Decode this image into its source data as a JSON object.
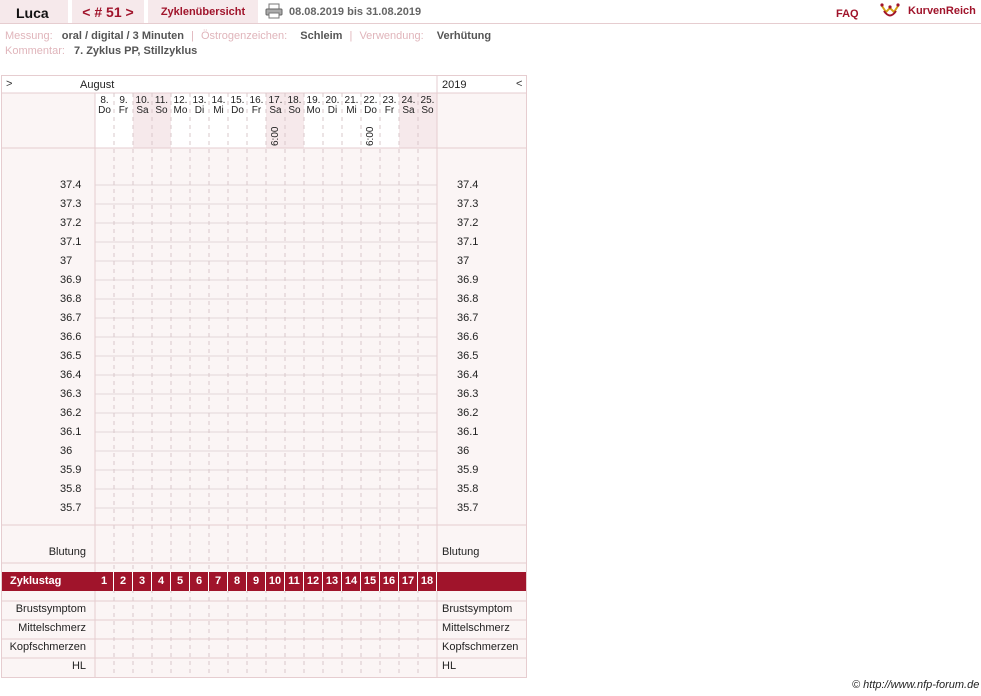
{
  "header": {
    "name": "Luca",
    "cycle_label": "< # 51 >",
    "overview_label": "Zyklenübersicht",
    "date_range": "08.08.2019 bis 31.08.2019",
    "faq_label": "FAQ",
    "brand": "KurvenReich"
  },
  "meta": {
    "messung_label": "Messung:",
    "messung_value": "oral / digital / 3 Minuten",
    "oestrogen_label": "Östrogenzeichen:",
    "oestrogen_value": "Schleim",
    "verwendung_label": "Verwendung:",
    "verwendung_value": "Verhütung",
    "kommentar_label": "Kommentar:",
    "kommentar_value": "7. Zyklus PP, Stillzyklus"
  },
  "chart": {
    "nav_prev": ">",
    "nav_next": "<",
    "month": "August",
    "year": "2019",
    "days": [
      {
        "num": "8.",
        "wd": "Do",
        "weekend": false,
        "time": ""
      },
      {
        "num": "9.",
        "wd": "Fr",
        "weekend": false,
        "time": ""
      },
      {
        "num": "10.",
        "wd": "Sa",
        "weekend": true,
        "time": ""
      },
      {
        "num": "11.",
        "wd": "So",
        "weekend": true,
        "time": ""
      },
      {
        "num": "12.",
        "wd": "Mo",
        "weekend": false,
        "time": ""
      },
      {
        "num": "13.",
        "wd": "Di",
        "weekend": false,
        "time": ""
      },
      {
        "num": "14.",
        "wd": "Mi",
        "weekend": false,
        "time": ""
      },
      {
        "num": "15.",
        "wd": "Do",
        "weekend": false,
        "time": ""
      },
      {
        "num": "16.",
        "wd": "Fr",
        "weekend": false,
        "time": ""
      },
      {
        "num": "17.",
        "wd": "Sa",
        "weekend": true,
        "time": "6:00"
      },
      {
        "num": "18.",
        "wd": "So",
        "weekend": true,
        "time": ""
      },
      {
        "num": "19.",
        "wd": "Mo",
        "weekend": false,
        "time": ""
      },
      {
        "num": "20.",
        "wd": "Di",
        "weekend": false,
        "time": ""
      },
      {
        "num": "21.",
        "wd": "Mi",
        "weekend": false,
        "time": ""
      },
      {
        "num": "22.",
        "wd": "Do",
        "weekend": false,
        "time": "6:00"
      },
      {
        "num": "23.",
        "wd": "Fr",
        "weekend": false,
        "time": ""
      },
      {
        "num": "24.",
        "wd": "Sa",
        "weekend": true,
        "time": ""
      },
      {
        "num": "25.",
        "wd": "So",
        "weekend": true,
        "time": ""
      }
    ],
    "temps": [
      "37.4",
      "37.3",
      "37.2",
      "37.1",
      "37",
      "36.9",
      "36.8",
      "36.7",
      "36.6",
      "36.5",
      "36.4",
      "36.3",
      "36.2",
      "36.1",
      "36",
      "35.9",
      "35.8",
      "35.7"
    ],
    "blutung_label": "Blutung",
    "zyklustag_label": "Zyklustag",
    "zyklustage": [
      "1",
      "2",
      "3",
      "4",
      "5",
      "6",
      "7",
      "8",
      "9",
      "10",
      "11",
      "12",
      "13",
      "14",
      "15",
      "16",
      "17",
      "18"
    ],
    "symptoms": [
      "Brustsymptom",
      "Mittelschmerz",
      "Kopfschmerzen",
      "HL"
    ]
  },
  "footer": "© http://www.nfp-forum.de"
}
